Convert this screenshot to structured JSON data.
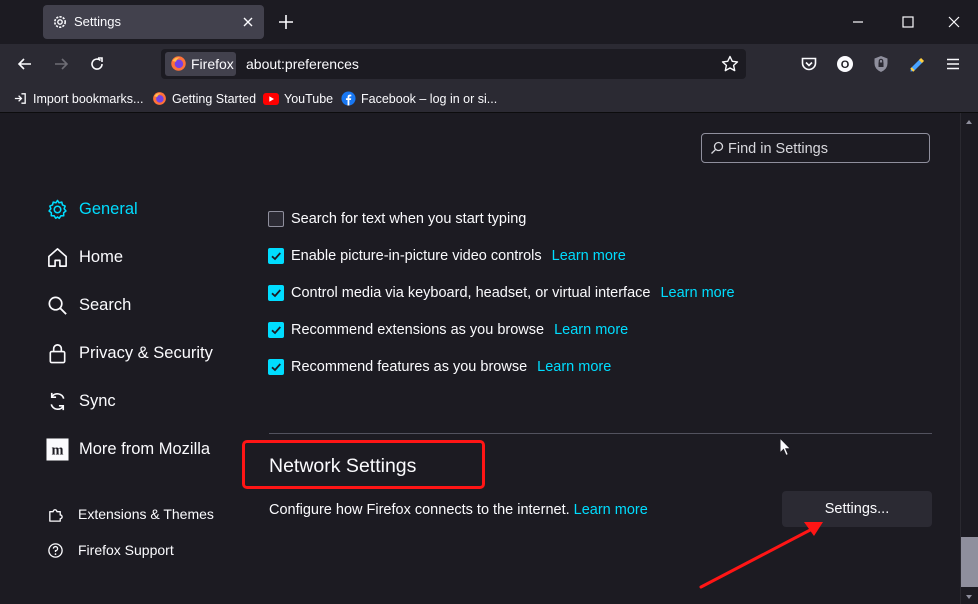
{
  "browser": {
    "tab": {
      "title": "Settings",
      "icon": "gear-icon"
    },
    "new_tab_symbol": "+",
    "window_controls": [
      "minimize",
      "maximize",
      "close"
    ],
    "identity_label": "Firefox",
    "url": "about:preferences",
    "toolbar_icons": [
      "pocket-icon",
      "account-icon",
      "shield-extension-icon",
      "pen-extension-icon",
      "menu-icon"
    ],
    "account_initial": "O",
    "bookmarks": [
      {
        "label": "Import bookmarks...",
        "icon": "import-icon"
      },
      {
        "label": "Getting Started",
        "icon": "firefox-icon"
      },
      {
        "label": "YouTube",
        "icon": "youtube-icon"
      },
      {
        "label": "Facebook – log in or si...",
        "icon": "facebook-icon"
      }
    ]
  },
  "search": {
    "placeholder": "Find in Settings"
  },
  "sidebar": {
    "items": [
      {
        "label": "General",
        "icon": "gear-icon",
        "active": true
      },
      {
        "label": "Home",
        "icon": "home-icon"
      },
      {
        "label": "Search",
        "icon": "search-icon"
      },
      {
        "label": "Privacy & Security",
        "icon": "lock-icon"
      },
      {
        "label": "Sync",
        "icon": "sync-icon"
      },
      {
        "label": "More from Mozilla",
        "icon": "mozilla-icon"
      }
    ],
    "footer": [
      {
        "label": "Extensions & Themes",
        "icon": "puzzle-icon"
      },
      {
        "label": "Firefox Support",
        "icon": "help-icon"
      }
    ]
  },
  "options": [
    {
      "label": "Search for text when you start typing",
      "checked": false,
      "link": ""
    },
    {
      "label": "Enable picture-in-picture video controls",
      "checked": true,
      "link": "Learn more"
    },
    {
      "label": "Control media via keyboard, headset, or virtual interface",
      "checked": true,
      "link": "Learn more"
    },
    {
      "label": "Recommend extensions as you browse",
      "checked": true,
      "link": "Learn more"
    },
    {
      "label": "Recommend features as you browse",
      "checked": true,
      "link": "Learn more"
    }
  ],
  "network": {
    "title": "Network Settings",
    "description": "Configure how Firefox connects to the internet.",
    "link": "Learn more",
    "button": "Settings..."
  },
  "colors": {
    "accent": "#00ddff",
    "background": "#1c1b22",
    "toolbar": "#2b2a33",
    "annotation": "#ff1515"
  }
}
